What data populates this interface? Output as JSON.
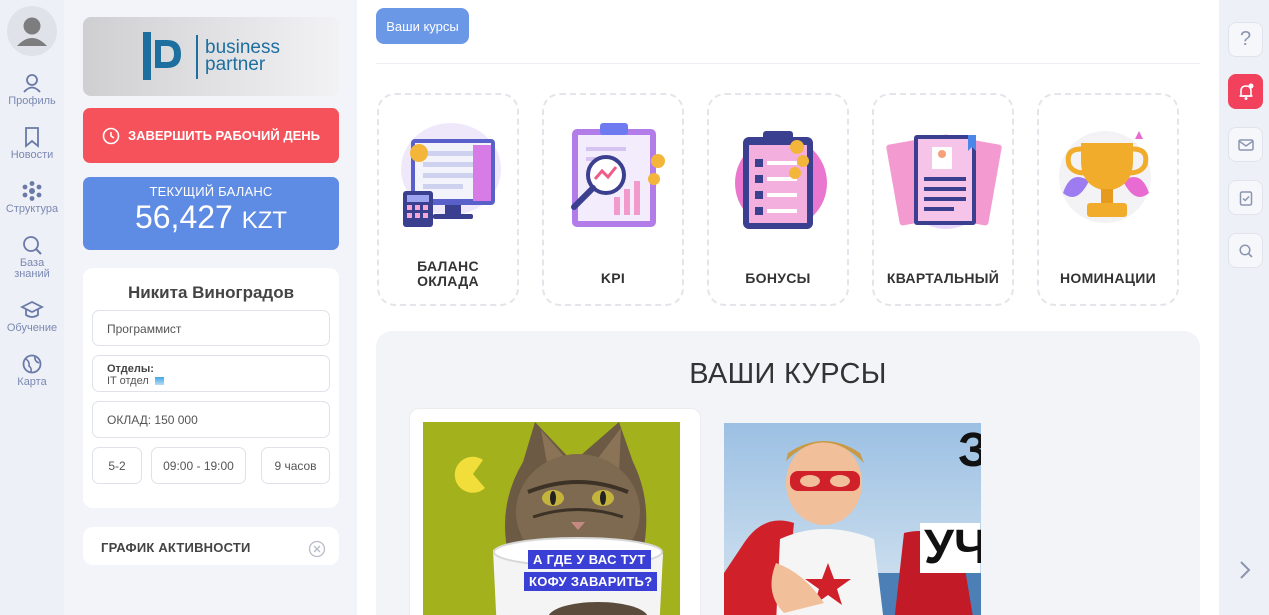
{
  "nav": {
    "items": [
      {
        "label": "Профиль",
        "icon": "profile-icon"
      },
      {
        "label": "Новости",
        "icon": "bookmark-icon"
      },
      {
        "label": "Структура",
        "icon": "structure-icon"
      },
      {
        "label": "База\nзнаний",
        "icon": "search-icon"
      },
      {
        "label": "Обучение",
        "icon": "graduation-cap-icon"
      },
      {
        "label": "Карта",
        "icon": "globe-icon"
      }
    ]
  },
  "logo": {
    "line1": "business",
    "line2": "partner"
  },
  "end_day": {
    "label": "ЗАВЕРШИТЬ РАБОЧИЙ ДЕНЬ"
  },
  "balance": {
    "title": "ТЕКУЩИЙ БАЛАНС",
    "value": "56,427",
    "currency": "KZT"
  },
  "profile": {
    "name": "Никита Виноградов",
    "position": "Программист",
    "departments_label": "Отделы:",
    "department": "IT отдел",
    "salary": "ОКЛАД: 150 000",
    "schedule": "5-2",
    "hours_range": "09:00 - 19:00",
    "hours_total": "9 часов"
  },
  "activity": {
    "label": "ГРАФИК АКТИВНОСТИ"
  },
  "main": {
    "tab": "Ваши курсы",
    "tiles": [
      {
        "label1": "БАЛАНС",
        "label2": "ОКЛАДА",
        "icon": "salary-monitor-icon"
      },
      {
        "label1": "KPI",
        "label2": "",
        "icon": "kpi-chart-icon"
      },
      {
        "label1": "БОНУСЫ",
        "label2": "",
        "icon": "bonus-clipboard-icon"
      },
      {
        "label1": "КВАРТАЛЬНЫЙ",
        "label2": "",
        "icon": "quarterly-docs-icon"
      },
      {
        "label1": "НОМИНАЦИИ",
        "label2": "",
        "icon": "trophy-icon"
      }
    ],
    "courses_title": "ВАШИ КУРСЫ",
    "course_cards": [
      {
        "caption1": "А ГДЕ У ВАС ТУТ",
        "caption2": "КОФУ ЗАВАРИТЬ?",
        "image": "cat-with-cup"
      },
      {
        "caption1": "З",
        "caption2": "УЧ",
        "image": "superhero-kid"
      }
    ]
  },
  "rail": {
    "help": "?",
    "icons": [
      "help-icon",
      "bell-icon",
      "mail-icon",
      "clipboard-check-icon",
      "search-icon",
      "chevron-right-icon"
    ]
  },
  "colors": {
    "accent_blue": "#5e8be3",
    "danger_red": "#f5525b",
    "bell_red": "#f1415d",
    "tab_blue": "#6a97e6"
  }
}
